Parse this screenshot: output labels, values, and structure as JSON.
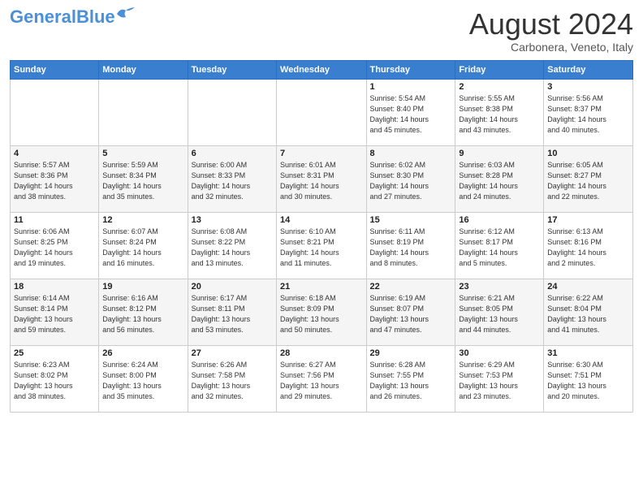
{
  "header": {
    "logo_general": "General",
    "logo_blue": "Blue",
    "month_year": "August 2024",
    "location": "Carbonera, Veneto, Italy"
  },
  "weekdays": [
    "Sunday",
    "Monday",
    "Tuesday",
    "Wednesday",
    "Thursday",
    "Friday",
    "Saturday"
  ],
  "rows": [
    [
      {
        "day": "",
        "info": ""
      },
      {
        "day": "",
        "info": ""
      },
      {
        "day": "",
        "info": ""
      },
      {
        "day": "",
        "info": ""
      },
      {
        "day": "1",
        "info": "Sunrise: 5:54 AM\nSunset: 8:40 PM\nDaylight: 14 hours\nand 45 minutes."
      },
      {
        "day": "2",
        "info": "Sunrise: 5:55 AM\nSunset: 8:38 PM\nDaylight: 14 hours\nand 43 minutes."
      },
      {
        "day": "3",
        "info": "Sunrise: 5:56 AM\nSunset: 8:37 PM\nDaylight: 14 hours\nand 40 minutes."
      }
    ],
    [
      {
        "day": "4",
        "info": "Sunrise: 5:57 AM\nSunset: 8:36 PM\nDaylight: 14 hours\nand 38 minutes."
      },
      {
        "day": "5",
        "info": "Sunrise: 5:59 AM\nSunset: 8:34 PM\nDaylight: 14 hours\nand 35 minutes."
      },
      {
        "day": "6",
        "info": "Sunrise: 6:00 AM\nSunset: 8:33 PM\nDaylight: 14 hours\nand 32 minutes."
      },
      {
        "day": "7",
        "info": "Sunrise: 6:01 AM\nSunset: 8:31 PM\nDaylight: 14 hours\nand 30 minutes."
      },
      {
        "day": "8",
        "info": "Sunrise: 6:02 AM\nSunset: 8:30 PM\nDaylight: 14 hours\nand 27 minutes."
      },
      {
        "day": "9",
        "info": "Sunrise: 6:03 AM\nSunset: 8:28 PM\nDaylight: 14 hours\nand 24 minutes."
      },
      {
        "day": "10",
        "info": "Sunrise: 6:05 AM\nSunset: 8:27 PM\nDaylight: 14 hours\nand 22 minutes."
      }
    ],
    [
      {
        "day": "11",
        "info": "Sunrise: 6:06 AM\nSunset: 8:25 PM\nDaylight: 14 hours\nand 19 minutes."
      },
      {
        "day": "12",
        "info": "Sunrise: 6:07 AM\nSunset: 8:24 PM\nDaylight: 14 hours\nand 16 minutes."
      },
      {
        "day": "13",
        "info": "Sunrise: 6:08 AM\nSunset: 8:22 PM\nDaylight: 14 hours\nand 13 minutes."
      },
      {
        "day": "14",
        "info": "Sunrise: 6:10 AM\nSunset: 8:21 PM\nDaylight: 14 hours\nand 11 minutes."
      },
      {
        "day": "15",
        "info": "Sunrise: 6:11 AM\nSunset: 8:19 PM\nDaylight: 14 hours\nand 8 minutes."
      },
      {
        "day": "16",
        "info": "Sunrise: 6:12 AM\nSunset: 8:17 PM\nDaylight: 14 hours\nand 5 minutes."
      },
      {
        "day": "17",
        "info": "Sunrise: 6:13 AM\nSunset: 8:16 PM\nDaylight: 14 hours\nand 2 minutes."
      }
    ],
    [
      {
        "day": "18",
        "info": "Sunrise: 6:14 AM\nSunset: 8:14 PM\nDaylight: 13 hours\nand 59 minutes."
      },
      {
        "day": "19",
        "info": "Sunrise: 6:16 AM\nSunset: 8:12 PM\nDaylight: 13 hours\nand 56 minutes."
      },
      {
        "day": "20",
        "info": "Sunrise: 6:17 AM\nSunset: 8:11 PM\nDaylight: 13 hours\nand 53 minutes."
      },
      {
        "day": "21",
        "info": "Sunrise: 6:18 AM\nSunset: 8:09 PM\nDaylight: 13 hours\nand 50 minutes."
      },
      {
        "day": "22",
        "info": "Sunrise: 6:19 AM\nSunset: 8:07 PM\nDaylight: 13 hours\nand 47 minutes."
      },
      {
        "day": "23",
        "info": "Sunrise: 6:21 AM\nSunset: 8:05 PM\nDaylight: 13 hours\nand 44 minutes."
      },
      {
        "day": "24",
        "info": "Sunrise: 6:22 AM\nSunset: 8:04 PM\nDaylight: 13 hours\nand 41 minutes."
      }
    ],
    [
      {
        "day": "25",
        "info": "Sunrise: 6:23 AM\nSunset: 8:02 PM\nDaylight: 13 hours\nand 38 minutes."
      },
      {
        "day": "26",
        "info": "Sunrise: 6:24 AM\nSunset: 8:00 PM\nDaylight: 13 hours\nand 35 minutes."
      },
      {
        "day": "27",
        "info": "Sunrise: 6:26 AM\nSunset: 7:58 PM\nDaylight: 13 hours\nand 32 minutes."
      },
      {
        "day": "28",
        "info": "Sunrise: 6:27 AM\nSunset: 7:56 PM\nDaylight: 13 hours\nand 29 minutes."
      },
      {
        "day": "29",
        "info": "Sunrise: 6:28 AM\nSunset: 7:55 PM\nDaylight: 13 hours\nand 26 minutes."
      },
      {
        "day": "30",
        "info": "Sunrise: 6:29 AM\nSunset: 7:53 PM\nDaylight: 13 hours\nand 23 minutes."
      },
      {
        "day": "31",
        "info": "Sunrise: 6:30 AM\nSunset: 7:51 PM\nDaylight: 13 hours\nand 20 minutes."
      }
    ]
  ]
}
